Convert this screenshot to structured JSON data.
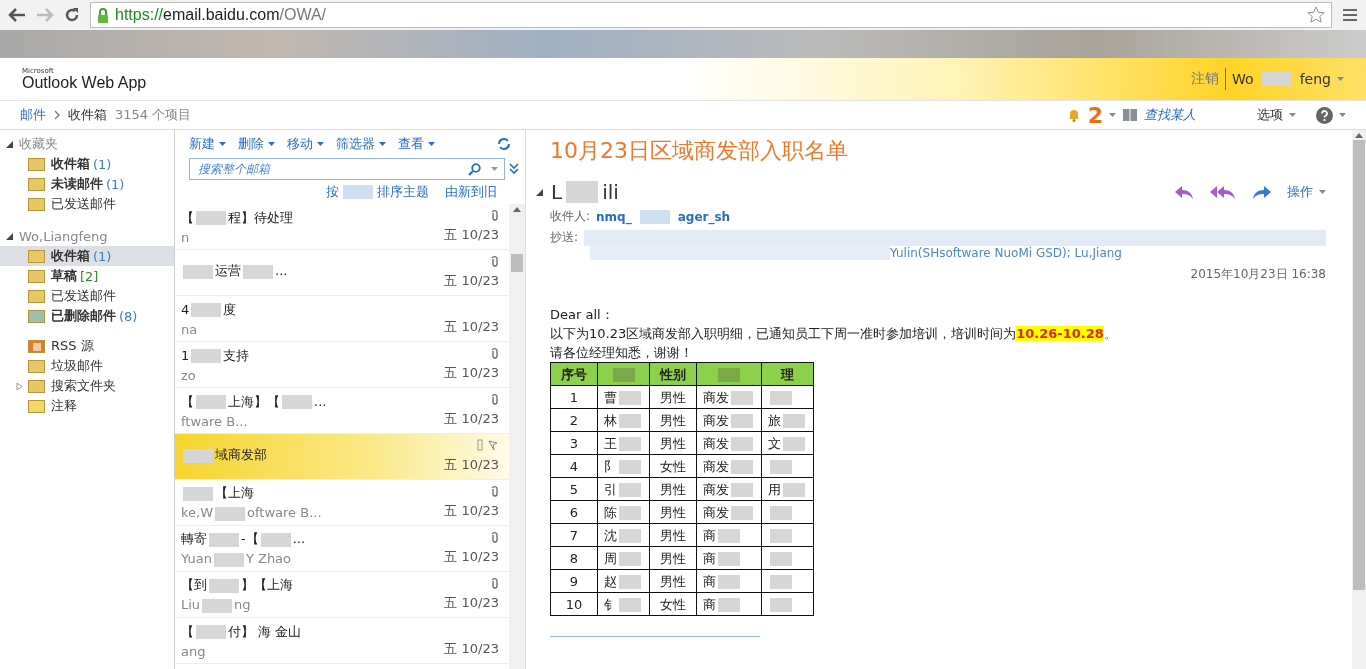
{
  "browser": {
    "url_scheme": "https://",
    "url_host": "email.baidu.com",
    "url_path": "/OWA/"
  },
  "header": {
    "brand_small": "Microsoft",
    "brand": "Outlook Web App",
    "signout": "注销",
    "user_start": "Wo",
    "user_end": "feng"
  },
  "breadcrumb": {
    "root": "邮件",
    "folder": "收件箱",
    "count": "3154 个项目"
  },
  "toolbar_right": {
    "reminders": "2",
    "find_people": "查找某人",
    "options": "选项"
  },
  "nav": [
    {
      "title": "收藏夹",
      "expanded": true,
      "items": [
        {
          "kind": "inbox",
          "label": "收件箱",
          "count": "(1)",
          "color": "#3a7fd1",
          "bold": true,
          "selected": false
        },
        {
          "kind": "unread",
          "label": "未读邮件",
          "count": "(1)",
          "color": "#3a7fd1",
          "bold": true,
          "selected": false
        },
        {
          "kind": "sent",
          "label": "已发送邮件",
          "bold": false,
          "selected": false
        }
      ]
    },
    {
      "title": "Wo,Liangfeng",
      "expanded": true,
      "items": [
        {
          "kind": "inbox",
          "label": "收件箱",
          "count": "(1)",
          "color": "#3a7fd1",
          "bold": true,
          "selected": true
        },
        {
          "kind": "drafts",
          "label": "草稿",
          "count": "[2]",
          "color": "#2e8b2e",
          "bold": true,
          "selected": false
        },
        {
          "kind": "sent",
          "label": "已发送邮件",
          "bold": false,
          "selected": false
        },
        {
          "kind": "deleted",
          "label": "已删除邮件",
          "count": "(8)",
          "color": "#3a7fd1",
          "bold": true,
          "selected": false
        },
        {
          "kind": "rss",
          "label": "RSS 源",
          "bold": false,
          "selected": false
        },
        {
          "kind": "junk",
          "label": "垃圾邮件",
          "bold": false,
          "selected": false
        },
        {
          "kind": "search",
          "label": "搜索文件夹",
          "bold": false,
          "selected": false,
          "expanded": false
        },
        {
          "kind": "notes",
          "label": "注释",
          "bold": false,
          "selected": false
        }
      ]
    }
  ],
  "list_toolbar": [
    "新建",
    "删除",
    "移动",
    "筛选器",
    "查看"
  ],
  "search": {
    "placeholder": "搜索整个邮箱"
  },
  "sort": {
    "left": "按",
    "mid": "排序主题",
    "order": "由新到旧"
  },
  "messages": [
    {
      "subject": "【",
      "subject_2": "程】待处理",
      "sender": "n",
      "date": "五 10/23",
      "attachment": true,
      "selected": false
    },
    {
      "subject_2": "运营",
      "subject_end": "...",
      "date": "五 10/23",
      "attachment": true,
      "selected": false
    },
    {
      "subject": "4",
      "subject_2": "度",
      "sender": "na",
      "date": "五 10/23",
      "attachment": false,
      "selected": false
    },
    {
      "subject": "1",
      "subject_2": "支持",
      "sender": "zo",
      "date": "五 10/23",
      "attachment": true,
      "selected": false
    },
    {
      "subject": "【",
      "subject_2": "上海】【",
      "subject_end": "...",
      "sender": "ftware B",
      "sender_end": "...",
      "date": "五 10/23",
      "attachment": true,
      "selected": false
    },
    {
      "subject_2": "域商发部",
      "date": "五 10/23",
      "attachment": false,
      "selected": true
    },
    {
      "subject_2": "【上海",
      "sender": "ke,W",
      "sender_2": "oftware B",
      "sender_end": "...",
      "date": "五 10/23",
      "attachment": true,
      "selected": false
    },
    {
      "subject": "轉寄",
      "subject_2": "-【",
      "subject_end": "...",
      "sender": "Yuan",
      "sender_2": "Y  Zhao",
      "date": "五 10/23",
      "attachment": true,
      "selected": false
    },
    {
      "subject": "【到",
      "subject_2": "】【上海",
      "sender": "Liu",
      "sender_2": "ng",
      "date": "五 10/23",
      "attachment": true,
      "selected": false
    },
    {
      "subject": "【",
      "subject_2": "付】 海  金山",
      "sender": "ang",
      "date": "五 10/23",
      "attachment": false,
      "selected": false
    }
  ],
  "email": {
    "title": "10月23日区域商发部入职名单",
    "sender_start": "L",
    "sender_end": "ili",
    "actions": "操作",
    "to_label": "收件人:",
    "to": "nmq_",
    "to_end": "ager_sh",
    "cc_label": "抄送:",
    "cc_end": "Yulin(SHsoftware NuoMi GSD); Lu,Jiang",
    "date": "2015年10月23日 16:38",
    "greeting": "Dear all：",
    "line": "以下为10.23区域商发部入职明细，已通知员工下周一准时参加培训，培训时间为",
    "highlight": "10.26-10.28",
    "line_end": "。",
    "closing": "请各位经理知悉，谢谢！"
  },
  "table": {
    "columns": [
      "序号",
      null,
      "性别",
      null,
      "理"
    ],
    "rows": [
      {
        "no": "1",
        "name": "曹",
        "gender": "男性",
        "dept": "商发"
      },
      {
        "no": "2",
        "name": "林",
        "gender": "男性",
        "dept": "商发",
        "manager": "旅"
      },
      {
        "no": "3",
        "name": "王",
        "gender": "男性",
        "dept": "商发",
        "manager": "文"
      },
      {
        "no": "4",
        "name": "阝",
        "gender": "女性",
        "dept": "商发"
      },
      {
        "no": "5",
        "name": "引",
        "gender": "男性",
        "dept": "商发",
        "manager": "用"
      },
      {
        "no": "6",
        "name": "陈",
        "gender": "男性",
        "dept": "商发"
      },
      {
        "no": "7",
        "name": "沈",
        "gender": "男性",
        "dept": "商"
      },
      {
        "no": "8",
        "name": "周",
        "gender": "男性",
        "dept": "商"
      },
      {
        "no": "9",
        "name": "赵",
        "gender": "男性",
        "dept": "商"
      },
      {
        "no": "10",
        "name": "钅",
        "gender": "女性",
        "dept": "商"
      }
    ]
  }
}
